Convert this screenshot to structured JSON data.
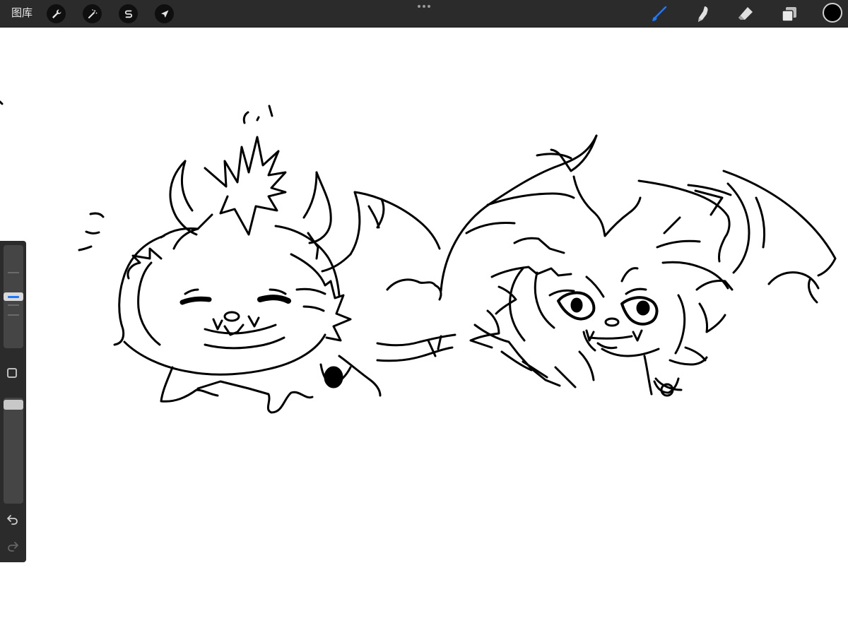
{
  "toolbar": {
    "gallery_label": "图库",
    "left_tools": [
      {
        "name": "actions",
        "icon": "wrench-icon"
      },
      {
        "name": "adjustments",
        "icon": "magic-wand-icon"
      },
      {
        "name": "selection",
        "icon": "selection-s-icon"
      },
      {
        "name": "transform",
        "icon": "arrow-cursor-icon"
      }
    ],
    "right_tools": [
      {
        "name": "brush",
        "icon": "brush-icon",
        "active": true
      },
      {
        "name": "smudge",
        "icon": "smudge-finger-icon",
        "active": false
      },
      {
        "name": "eraser",
        "icon": "eraser-icon",
        "active": false
      },
      {
        "name": "layers",
        "icon": "layers-icon",
        "active": false
      }
    ],
    "current_color": "#000000",
    "active_color": "#1e78ff"
  },
  "sidebar": {
    "brush_size_level": 0.5,
    "brush_opacity_level": 0.02,
    "icons": [
      "modify-square-icon",
      "undo-icon",
      "redo-icon"
    ]
  },
  "canvas": {
    "background": "#ffffff",
    "ink_color": "#000000"
  }
}
